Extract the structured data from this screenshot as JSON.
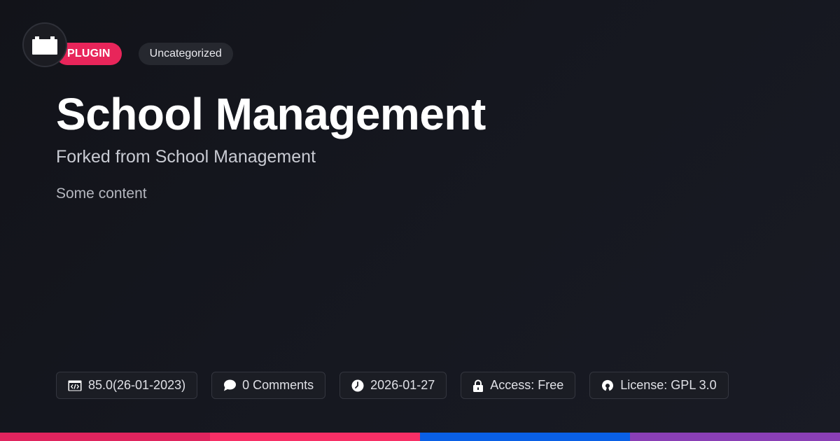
{
  "tags": {
    "type": "PLUGIN",
    "category": "Uncategorized"
  },
  "title": "School Management",
  "subtitle": "Forked from School Management",
  "content": "Some content",
  "meta": {
    "version": "85.0(26-01-2023)",
    "comments": "0 Comments",
    "date": "2026-01-27",
    "access": "Access: Free",
    "license": "License: GPL 3.0"
  },
  "icons": {
    "logo": "plugin-block-icon",
    "version": "code-window-icon",
    "comments": "speech-bubble-icon",
    "date": "clock-icon",
    "access": "lock-icon",
    "license": "open-source-icon"
  },
  "colors": {
    "background": "#14161d",
    "plugin_tag": "#e8255a",
    "bar": [
      "#e0245e",
      "#f72f66",
      "#0a60e6",
      "#8a3fb6"
    ]
  }
}
